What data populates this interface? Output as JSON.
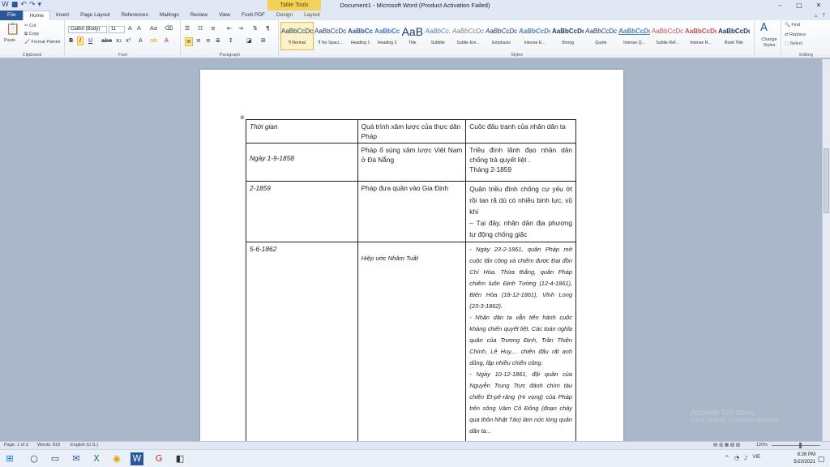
{
  "window": {
    "title": "Document1 - Microsoft Word (Product Activation Failed)",
    "context_tab_group": "Table Tools"
  },
  "tabs": [
    "File",
    "Home",
    "Insert",
    "Page Layout",
    "References",
    "Mailings",
    "Review",
    "View",
    "Foxit PDF",
    "Design",
    "Layout"
  ],
  "ribbon": {
    "clipboard": {
      "paste": "Paste",
      "cut": "Cut",
      "copy": "Copy",
      "format_painter": "Format Painter",
      "label": "Clipboard"
    },
    "font": {
      "name": "Calibri (Body)",
      "size": "11",
      "label": "Font"
    },
    "paragraph": {
      "label": "Paragraph"
    },
    "styles": {
      "label": "Styles",
      "items": [
        {
          "preview": "AaBbCcDc",
          "name": "¶ Normal"
        },
        {
          "preview": "AaBbCcDc",
          "name": "¶ No Spaci..."
        },
        {
          "preview": "AaBbCc",
          "name": "Heading 1"
        },
        {
          "preview": "AaBbCc",
          "name": "Heading 2"
        },
        {
          "preview": "AaB",
          "name": "Title"
        },
        {
          "preview": "AaBbCc.",
          "name": "Subtitle"
        },
        {
          "preview": "AaBbCcDc",
          "name": "Subtle Em..."
        },
        {
          "preview": "AaBbCcDc",
          "name": "Emphasis"
        },
        {
          "preview": "AaBbCcDc",
          "name": "Intense E..."
        },
        {
          "preview": "AaBbCcDc",
          "name": "Strong"
        },
        {
          "preview": "AaBbCcDc",
          "name": "Quote"
        },
        {
          "preview": "AaBbCcDc",
          "name": "Intense Q..."
        },
        {
          "preview": "AaBbCcDc",
          "name": "Subtle Ref..."
        },
        {
          "preview": "AaBbCcDc",
          "name": "Intense R..."
        },
        {
          "preview": "AaBbCcDc",
          "name": "Book Title"
        }
      ]
    },
    "change_styles": "Change Styles",
    "editing": {
      "find": "Find",
      "replace": "Replace",
      "select": "Select",
      "label": "Editing"
    }
  },
  "table": {
    "header": [
      "Thời gian",
      "Quá trình xâm lược của thực dân Pháp",
      "Cuộc đấu tranh của nhân dân ta"
    ],
    "row1": {
      "time": "Ngày 1-9-1858",
      "invasion": " Pháp ổ súng xâm lược Việt Nam ở Đà Nẵng",
      "struggle_1": "Triều đình lãnh đạo nhân dân chống trả quyết liệt .",
      "struggle_2": "Tháng 2-1859"
    },
    "row2": {
      "time": "2-1859",
      "invasion": "Pháp đưa quân vào Gia Định",
      "struggle_1": "Quân triều đình chống cự yếu ớt rồi tan rã  dù có nhiều binh lực, vũ khí",
      "struggle_2": "– Tại đây, nhân dân địa phương tự động chống giặc"
    },
    "row3": {
      "time": "5-6-1862",
      "invasion": "Hiệp ước Nhâm Tuất",
      "struggle_1": "- Ngày 23-2-1861, quân Pháp mở cuộc tấn công và chiếm được Đại đồn Chí Hòa. Thừa thắng, quân Pháp chiếm luôn Định Tường (12-4-1861), Biên Hòa (18-12-1861), Vĩnh Long (23-3-1862).",
      "struggle_2": "- Nhân dân ta vẫn tiến hành cuộc kháng chiến quyết liệt. Các toán nghĩa quân của Trương Định, Trần Thiện Chính, Lê Huy,... chiến đấu rất anh dũng, lập nhiều chiến công.",
      "struggle_3": "- Ngày 10-12-1861, đội quân của Nguyễn Trung Trực đánh chìm tàu chiến Ét-pê-răng (Hi vọng) của Pháp trên sông Vàm Cỏ Đông (đoạn chảy qua thôn Nhật Tảo) làm nức lòng quân dân ta..."
    }
  },
  "watermark": {
    "title": "Activate Windows",
    "subtitle": "Go to Settings to activate Windows."
  },
  "status": {
    "page": "Page: 1 of 3",
    "words": "Words: 818",
    "language": "English (U.S.)",
    "zoom": "120%"
  },
  "taskbar": {
    "time": "8:26 PM",
    "date": "5/20/2021",
    "lang": "VIE"
  }
}
